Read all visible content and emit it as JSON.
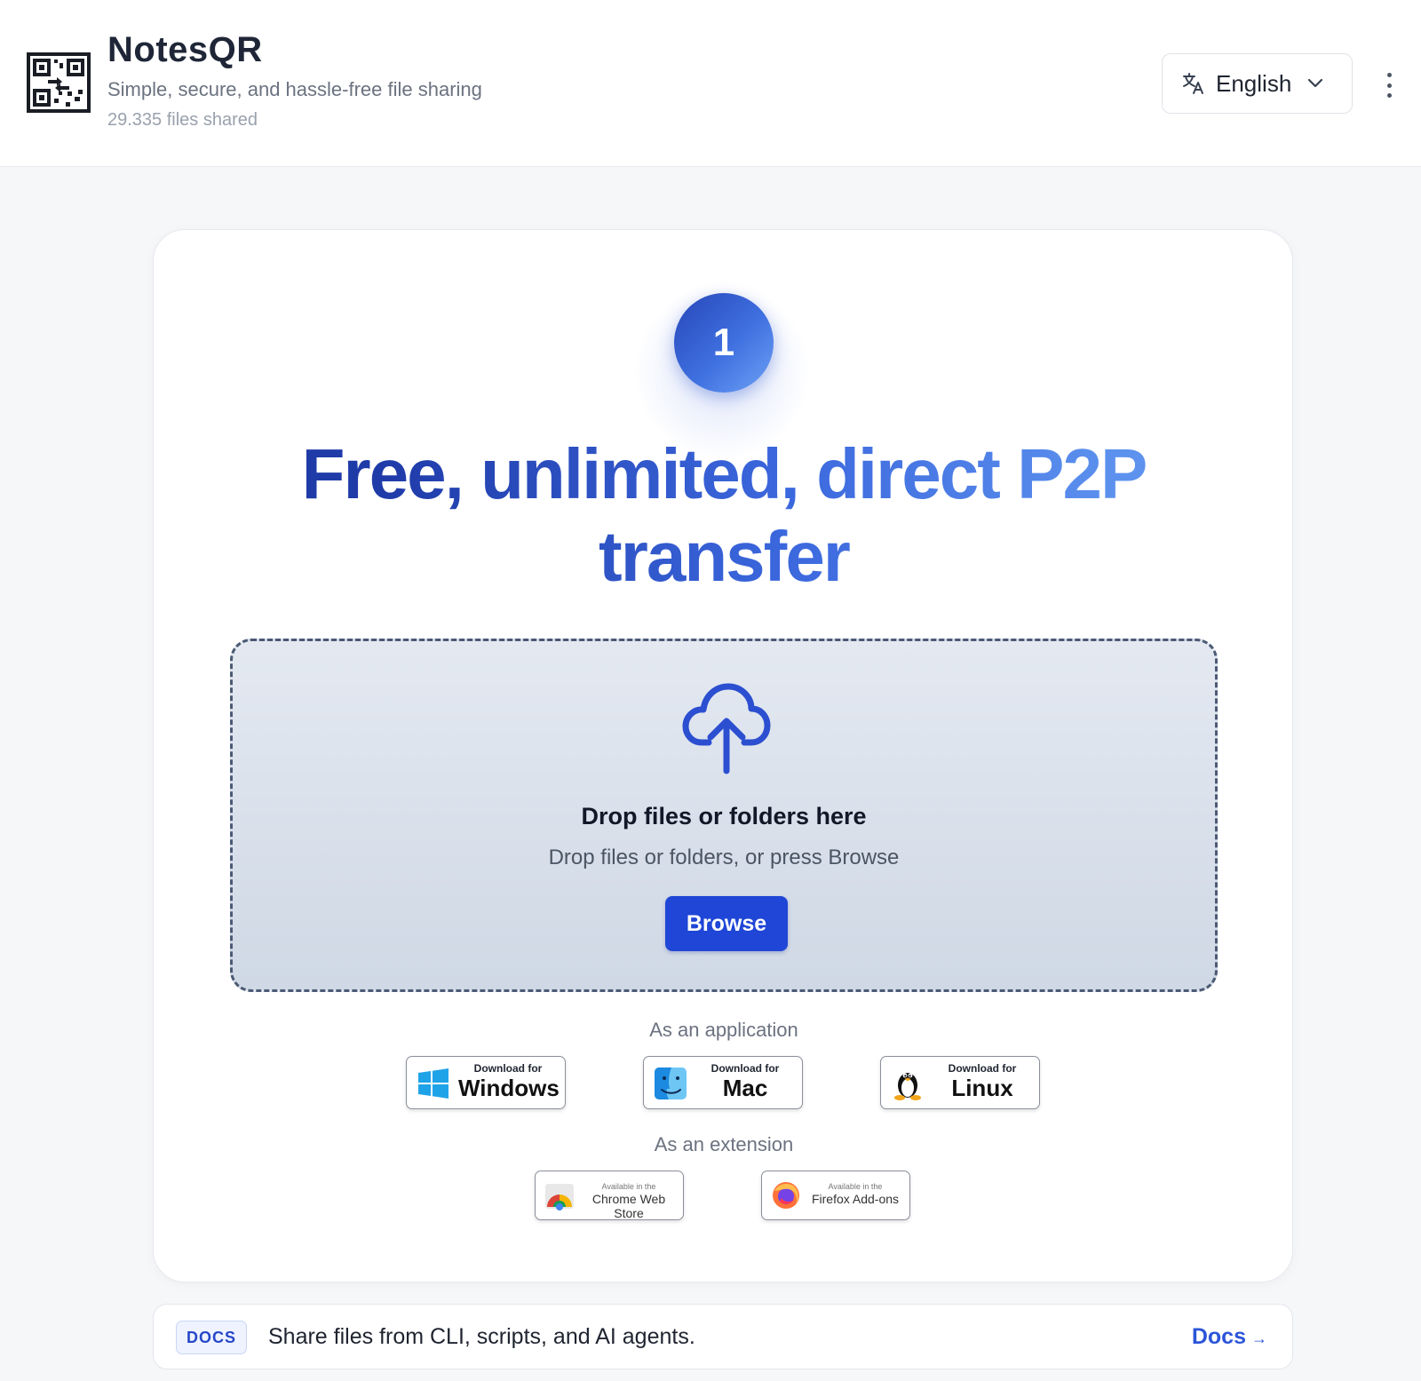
{
  "header": {
    "title": "NotesQR",
    "tagline": "Simple, secure, and hassle-free file sharing",
    "files_shared": "29.335 files shared",
    "language": "English",
    "icons": {
      "logo": "qr-code-logo",
      "language": "translate-icon",
      "dropdown": "chevron-down-icon",
      "menu": "more-vertical-icon"
    }
  },
  "hero": {
    "step_number": "1",
    "headline_line1": "Free, unlimited, direct P2P",
    "headline_line2": "transfer"
  },
  "dropzone": {
    "icon": "cloud-upload-icon",
    "title": "Drop files or folders here",
    "subtitle": "Drop files or folders, or press Browse",
    "browse_label": "Browse"
  },
  "downloads": {
    "app_label": "As an application",
    "apps": [
      {
        "small": "Download for",
        "big": "Windows",
        "icon": "windows-icon"
      },
      {
        "small": "Download for",
        "big": "Mac",
        "icon": "finder-icon"
      },
      {
        "small": "Download for",
        "big": "Linux",
        "icon": "tux-icon"
      }
    ],
    "ext_label": "As an extension",
    "extensions": [
      {
        "small": "Available in the",
        "big": "Chrome Web Store",
        "icon": "chrome-web-store-icon"
      },
      {
        "small": "Available in the",
        "big": "Firefox Add-ons",
        "icon": "firefox-icon"
      }
    ]
  },
  "docs_bar": {
    "tag": "DOCS",
    "text": "Share files from CLI, scripts, and AI agents.",
    "link_label": "Docs",
    "link_arrow": "→"
  },
  "colors": {
    "primary": "#1f46d6",
    "headline_start": "#1f3ba8",
    "headline_end": "#5d92ee",
    "dropzone_bg": "#d6dde8",
    "link": "#2c55d8"
  }
}
